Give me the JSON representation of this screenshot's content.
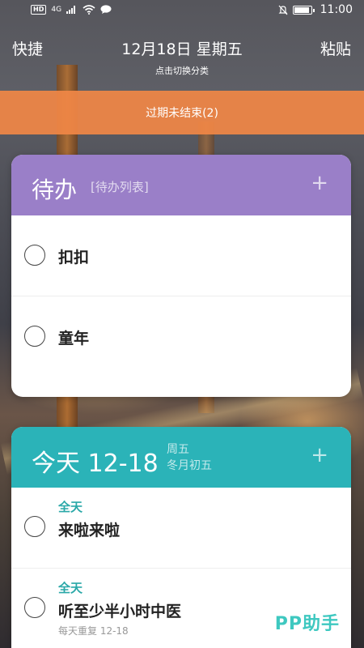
{
  "status_bar": {
    "hd": "HD",
    "network": "4G",
    "time": "11:00",
    "battery_level": 0.9
  },
  "header": {
    "left": "快捷",
    "date": "12月18日 星期五",
    "subtitle": "点击切换分类",
    "right": "粘贴"
  },
  "overdue_banner": {
    "text": "过期未结束(2)",
    "color": "#f08746"
  },
  "todo_card": {
    "title": "待办",
    "tag": "[待办列表]",
    "plus": "+",
    "color": "#9a7fc8",
    "items": [
      {
        "title": "扣扣"
      },
      {
        "title": "童年"
      }
    ]
  },
  "today_card": {
    "title": "今天 12-18",
    "weekday": "周五",
    "lunar": "冬月初五",
    "plus": "+",
    "color": "#2bb3b8",
    "items": [
      {
        "label": "全天",
        "title": "来啦来啦",
        "extra": ""
      },
      {
        "label": "全天",
        "title": "听至少半小时中医",
        "extra": "每天重复 12-18"
      }
    ]
  },
  "watermark": "PP助手",
  "icons": {
    "wifi": "wifi-icon",
    "message": "message-icon",
    "mute": "mute-icon",
    "battery": "battery-icon"
  }
}
